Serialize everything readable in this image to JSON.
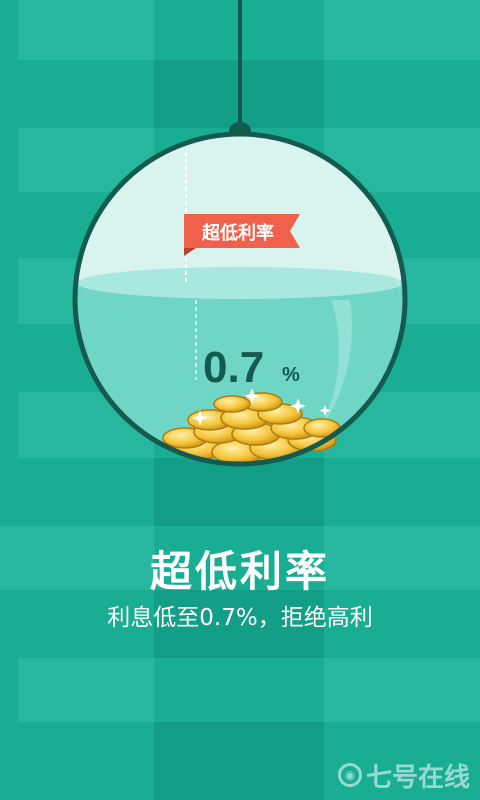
{
  "banner": {
    "label": "超低利率"
  },
  "rate": {
    "value": "0.7",
    "unit": "%"
  },
  "headline": {
    "title": "超低利率",
    "subtitle": "利息低至0.7%，拒绝高利"
  },
  "watermark": {
    "text": "七号在线"
  },
  "colors": {
    "background": "#19ad94",
    "ring": "#135a4f",
    "water": "#6fd6c6",
    "flag": "#f0614b",
    "coin": "#f5c43b"
  },
  "icons": [
    "coin-pile-icon",
    "sparkle-icon",
    "flag-icon",
    "watermark-logo-icon"
  ]
}
